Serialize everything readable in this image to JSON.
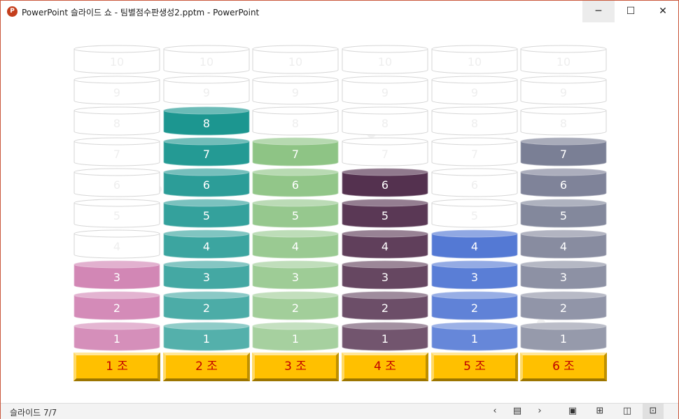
{
  "window": {
    "title": "PowerPoint 슬라이드 쇼  -  팀별점수판생성2.pptm - PowerPoint",
    "app_icon_text": "P",
    "minimize_glyph": "─",
    "maximize_glyph": "☐",
    "close_glyph": "✕"
  },
  "status": {
    "slide_counter": "슬라이드 7/7",
    "prev_glyph": "‹",
    "slides_menu_glyph": "▤",
    "next_glyph": "›",
    "normal_view_glyph": "▣",
    "sorter_view_glyph": "⊞",
    "reading_view_glyph": "◫",
    "slideshow_view_glyph": "⊡"
  },
  "board": {
    "levels": [
      "10",
      "9",
      "8",
      "7",
      "6",
      "5",
      "4",
      "3",
      "2",
      "1"
    ],
    "teams": [
      {
        "label": "1 조",
        "score": 3,
        "color": "#d287b5"
      },
      {
        "label": "2 조",
        "score": 8,
        "color": "#1c9690"
      },
      {
        "label": "3 조",
        "score": 7,
        "color": "#8ec485"
      },
      {
        "label": "4 조",
        "score": 6,
        "color": "#54314f"
      },
      {
        "label": "5 조",
        "score": 4,
        "color": "#5479d4"
      },
      {
        "label": "6 조",
        "score": 7,
        "color": "#7a7f95"
      }
    ]
  }
}
